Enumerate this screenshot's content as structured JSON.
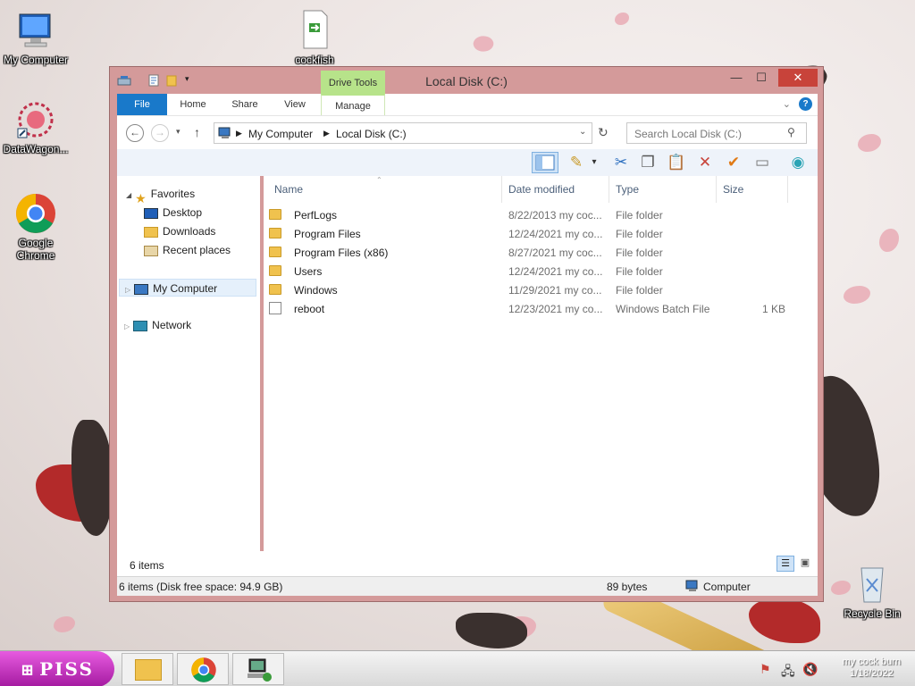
{
  "desktop": {
    "icons": [
      {
        "label": "My Computer"
      },
      {
        "label": "cockfish"
      },
      {
        "label": "DataWagon..."
      },
      {
        "label": "Google Chrome"
      },
      {
        "label": "Recycle Bin"
      }
    ]
  },
  "window": {
    "title": "Local Disk (C:)",
    "context_tab_group": "Drive Tools",
    "controls": {
      "minimize": "—",
      "maximize": "☐",
      "close": "✕"
    },
    "ribbon_tabs": [
      "File",
      "Home",
      "Share",
      "View",
      "Manage"
    ],
    "address": {
      "crumbs": [
        "My Computer",
        "Local Disk (C:)"
      ]
    },
    "search": {
      "placeholder": "Search Local Disk (C:)"
    },
    "navigation": {
      "favorites_label": "Favorites",
      "favorites": [
        "Desktop",
        "Downloads",
        "Recent places"
      ],
      "computer": "My Computer",
      "network": "Network"
    },
    "columns": [
      "Name",
      "Date modified",
      "Type",
      "Size"
    ],
    "files": [
      {
        "name": "PerfLogs",
        "date": "8/22/2013 my coc...",
        "type": "File folder",
        "size": "",
        "kind": "folder"
      },
      {
        "name": "Program Files",
        "date": "12/24/2021 my co...",
        "type": "File folder",
        "size": "",
        "kind": "folder"
      },
      {
        "name": "Program Files (x86)",
        "date": "8/27/2021 my coc...",
        "type": "File folder",
        "size": "",
        "kind": "folder"
      },
      {
        "name": "Users",
        "date": "12/24/2021 my co...",
        "type": "File folder",
        "size": "",
        "kind": "folder"
      },
      {
        "name": "Windows",
        "date": "11/29/2021 my co...",
        "type": "File folder",
        "size": "",
        "kind": "folder"
      },
      {
        "name": "reboot",
        "date": "12/23/2021 my co...",
        "type": "Windows Batch File",
        "size": "1 KB",
        "kind": "batch"
      }
    ],
    "item_count": "6 items",
    "status": {
      "summary": "6 items (Disk free space: 94.9 GB)",
      "bytes": "89 bytes",
      "location": "Computer"
    }
  },
  "taskbar": {
    "start_label": "PISS",
    "clock_line1": "my cock burn",
    "clock_line2": "1/18/2022"
  },
  "colors": {
    "window_frame": "#d49a9a",
    "file_tab": "#1979ca",
    "drive_tools": "#b7e38a",
    "close_button": "#c8433a",
    "start_button": "#c02ebc"
  }
}
